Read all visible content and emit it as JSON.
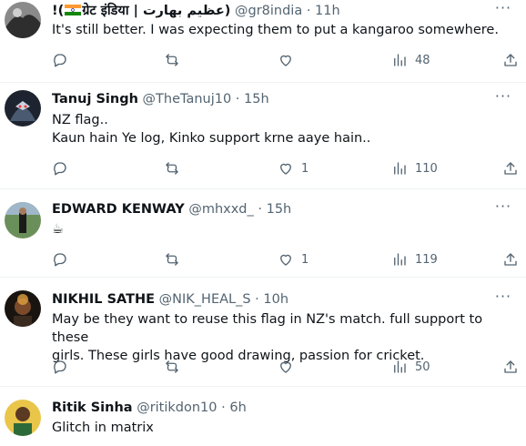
{
  "tweets": [
    {
      "name_prefix": "!(",
      "name_after_flag": "ग्रेट इंडिया | عظیم بھارت)",
      "handle": "@gr8india",
      "time": "11h",
      "text_lines": [
        "It's still better. I was expecting them to put a kangaroo somewhere."
      ],
      "likes": "",
      "views": "48"
    },
    {
      "name": "Tanuj Singh",
      "handle": "@TheTanuj10",
      "time": "15h",
      "text_lines": [
        "NZ flag..",
        "Kaun hain Ye log, Kinko support krne aaye hain.."
      ],
      "likes": "1",
      "views": "110"
    },
    {
      "name": "EDWARD KENWAY",
      "handle": "@mhxxd_",
      "time": "15h",
      "text_lines": [
        "☕"
      ],
      "likes": "1",
      "views": "119"
    },
    {
      "name": "NIKHIL SATHE",
      "handle": "@NIK_HEAL_S",
      "time": "10h",
      "text_lines": [
        "May be they want to reuse this flag in NZ's match. full support to these",
        "girls. These girls have good drawing, passion for cricket."
      ],
      "likes": "",
      "views": "50"
    },
    {
      "name": "Ritik Sinha",
      "handle": "@ritikdon10",
      "time": "6h",
      "text_lines": [
        "Glitch in matrix"
      ]
    }
  ],
  "icons": {
    "reply": "reply-icon",
    "retweet": "retweet-icon",
    "like": "heart-icon",
    "views": "views-icon",
    "share": "share-icon",
    "more": "more-icon"
  },
  "separator": " · "
}
